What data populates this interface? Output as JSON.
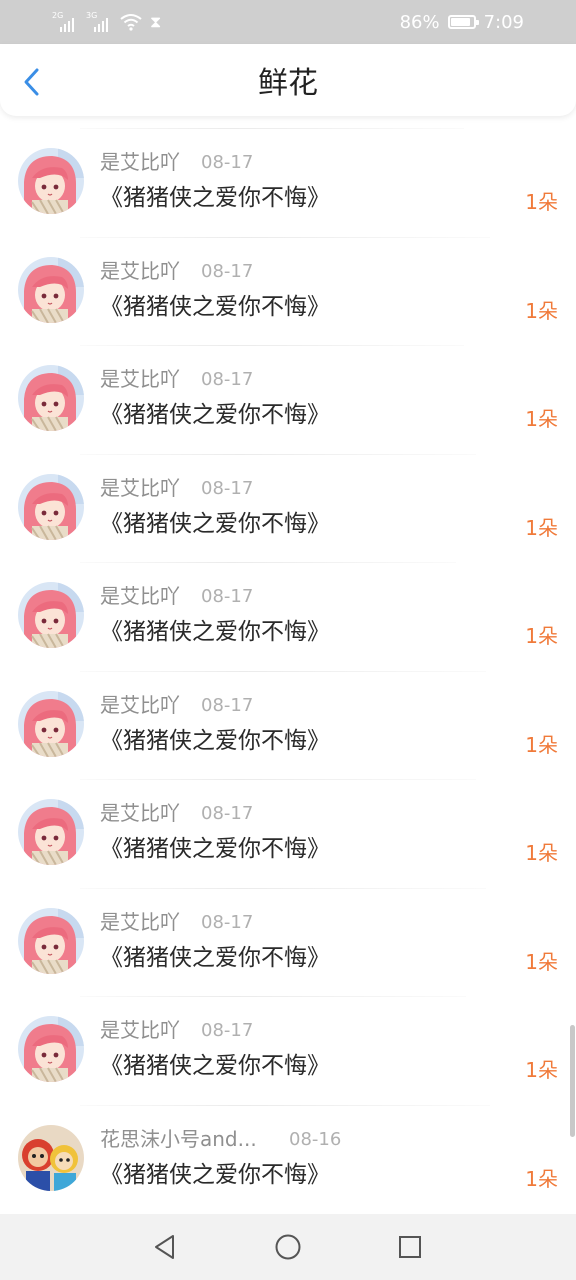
{
  "status_bar": {
    "sim1_tag": "2G",
    "sim2_tag": "3G",
    "battery_text": "86%",
    "battery_level": 0.86,
    "time": "7:09",
    "icons": [
      "signal-icon",
      "signal-icon",
      "wifi-icon",
      "hourglass-icon",
      "battery-icon"
    ]
  },
  "header": {
    "title": "鲜花",
    "back_icon": "chevron-left-icon"
  },
  "colors": {
    "accent_blue": "#3a8ee6",
    "count_orange": "#f07a3a",
    "username_gray": "#8f8f8f",
    "date_gray": "#b0b0b0"
  },
  "items": [
    {
      "avatar": "pink-hair-avatar",
      "user": "是艾比吖",
      "date": "08-17",
      "book": "《猪猪侠之爱你不悔》",
      "count": "1朵"
    },
    {
      "avatar": "pink-hair-avatar",
      "user": "是艾比吖",
      "date": "08-17",
      "book": "《猪猪侠之爱你不悔》",
      "count": "1朵"
    },
    {
      "avatar": "pink-hair-avatar",
      "user": "是艾比吖",
      "date": "08-17",
      "book": "《猪猪侠之爱你不悔》",
      "count": "1朵"
    },
    {
      "avatar": "pink-hair-avatar",
      "user": "是艾比吖",
      "date": "08-17",
      "book": "《猪猪侠之爱你不悔》",
      "count": "1朵"
    },
    {
      "avatar": "pink-hair-avatar",
      "user": "是艾比吖",
      "date": "08-17",
      "book": "《猪猪侠之爱你不悔》",
      "count": "1朵"
    },
    {
      "avatar": "pink-hair-avatar",
      "user": "是艾比吖",
      "date": "08-17",
      "book": "《猪猪侠之爱你不悔》",
      "count": "1朵"
    },
    {
      "avatar": "pink-hair-avatar",
      "user": "是艾比吖",
      "date": "08-17",
      "book": "《猪猪侠之爱你不悔》",
      "count": "1朵"
    },
    {
      "avatar": "pink-hair-avatar",
      "user": "是艾比吖",
      "date": "08-17",
      "book": "《猪猪侠之爱你不悔》",
      "count": "1朵"
    },
    {
      "avatar": "pink-hair-avatar",
      "user": "是艾比吖",
      "date": "08-17",
      "book": "《猪猪侠之爱你不悔》",
      "count": "1朵"
    },
    {
      "avatar": "cartoon-hero-avatar",
      "user": "花思沫小号and...",
      "date": "08-16",
      "book": "《猪猪侠之爱你不悔》",
      "count": "1朵"
    }
  ],
  "nav_bar": {
    "icons": [
      "back-triangle-icon",
      "home-circle-icon",
      "recents-square-icon"
    ]
  }
}
